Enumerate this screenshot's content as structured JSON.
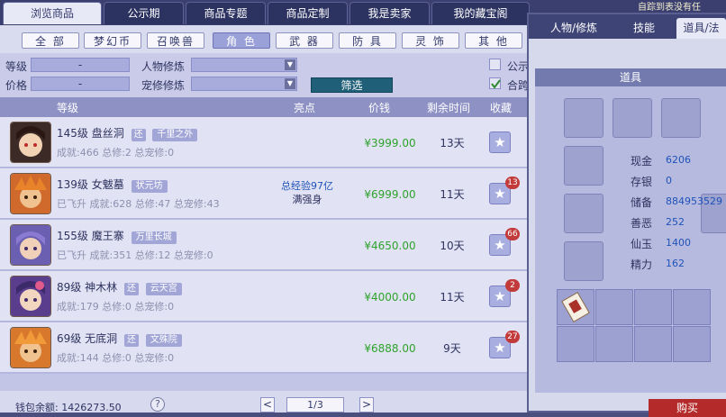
{
  "top_tabs": [
    "浏览商品",
    "公示期",
    "商品专题",
    "商品定制",
    "我是卖家",
    "我的藏宝阁"
  ],
  "notice_text": "自踪到表没有任",
  "categories": [
    "全 部",
    "梦幻币",
    "召唤兽",
    "角 色",
    "武 器",
    "防 具",
    "灵 饰",
    "其 他"
  ],
  "filters": {
    "level_label": "等级",
    "level_value": "-",
    "price_label": "价格",
    "price_value": "-",
    "char_practice_label": "人物修炼",
    "pet_practice_label": "宠修修炼",
    "filter_button": "筛选",
    "right_option_1": "公示",
    "right_option_2": "合跨"
  },
  "table_headers": {
    "level": "等级",
    "highlight": "亮点",
    "price": "价钱",
    "time_left": "剩余时间",
    "favorite": "收藏"
  },
  "listings": [
    {
      "level": "145级",
      "school": "盘丝洞",
      "huan": "还",
      "server": "千里之外",
      "stats": "成就:466 总修:2 总宠修:0",
      "highlight_1": "",
      "highlight_2": "",
      "price": "¥3999.00",
      "time_left": "13天",
      "fav_count": ""
    },
    {
      "level": "139级",
      "school": "女魃墓",
      "huan": "",
      "server": "状元坊",
      "stats": "已飞升 成就:628 总修:47 总宠修:43",
      "highlight_1": "总经验97亿",
      "highlight_2": "满强身",
      "price": "¥6999.00",
      "time_left": "11天",
      "fav_count": "13"
    },
    {
      "level": "155级",
      "school": "魔王寨",
      "huan": "",
      "server": "万里长城",
      "stats": "已飞升 成就:351 总修:12 总宠修:0",
      "highlight_1": "",
      "highlight_2": "",
      "price": "¥4650.00",
      "time_left": "10天",
      "fav_count": "66"
    },
    {
      "level": "89级",
      "school": "神木林",
      "huan": "还",
      "server": "云天宫",
      "stats": "成就:179 总修:0 总宠修:0",
      "highlight_1": "",
      "highlight_2": "",
      "price": "¥4000.00",
      "time_left": "11天",
      "fav_count": "2"
    },
    {
      "level": "69级",
      "school": "无底洞",
      "huan": "还",
      "server": "文殊院",
      "stats": "成就:144 总修:0 总宠修:0",
      "highlight_1": "",
      "highlight_2": "",
      "price": "¥6888.00",
      "time_left": "9天",
      "fav_count": "27"
    }
  ],
  "footer": {
    "wallet_label": "钱包余额: 1426273.50",
    "help_icon": "?",
    "page_indicator": "1/3",
    "prev_icon": "<",
    "next_icon": ">"
  },
  "detail": {
    "tabs": [
      "人物/修炼",
      "技能",
      "道具/法"
    ],
    "section_title": "道具",
    "props": [
      {
        "label": "现金",
        "value": "6206"
      },
      {
        "label": "存银",
        "value": "0"
      },
      {
        "label": "储备",
        "value": "884953529"
      },
      {
        "label": "善恶",
        "value": "252"
      },
      {
        "label": "仙玉",
        "value": "1400"
      },
      {
        "label": "精力",
        "value": "162"
      }
    ],
    "buy_button": "购买"
  },
  "colors": {
    "price_green": "#2fa32d",
    "highlight_blue": "#1f53b8",
    "badge_red": "#c33a3a",
    "buy_red": "#b42a2a"
  }
}
